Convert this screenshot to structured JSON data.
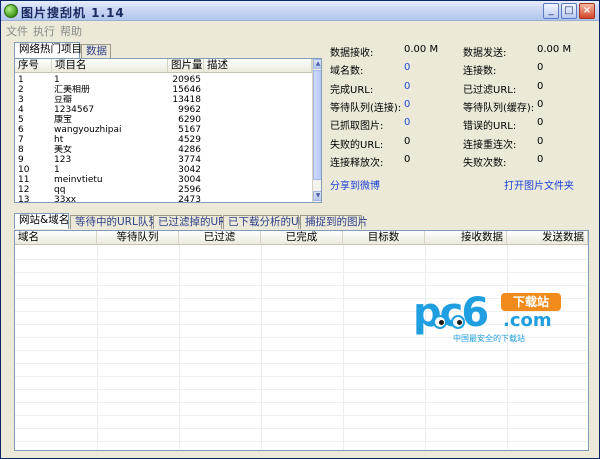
{
  "window": {
    "title": "图片搜刮机 1.14",
    "min": "_",
    "max": "□",
    "close": "×"
  },
  "menu": [
    "文件",
    "执行",
    "帮助"
  ],
  "top_tabs": [
    "网络热门项目",
    "数据"
  ],
  "top_grid": {
    "headers": [
      "序号",
      "项目名",
      "图片量",
      "描述"
    ],
    "rows": [
      [
        "1",
        "1",
        "20965",
        ""
      ],
      [
        "2",
        "汇美相册",
        "15646",
        ""
      ],
      [
        "3",
        "豆瓣",
        "13418",
        ""
      ],
      [
        "4",
        "1234567",
        "9962",
        ""
      ],
      [
        "5",
        "康宝",
        "6290",
        ""
      ],
      [
        "6",
        "wangyouzhipai",
        "5167",
        ""
      ],
      [
        "7",
        "ht",
        "4529",
        ""
      ],
      [
        "8",
        "美女",
        "4286",
        ""
      ],
      [
        "9",
        "123",
        "3774",
        ""
      ],
      [
        "10",
        "1",
        "3042",
        ""
      ],
      [
        "11",
        "meinvtietu",
        "3004",
        ""
      ],
      [
        "12",
        "qq",
        "2596",
        ""
      ],
      [
        "13",
        "33xx",
        "2473",
        ""
      ]
    ]
  },
  "stats_left": [
    {
      "label": "数据接收:",
      "value": "0.00 M",
      "blue": false
    },
    {
      "label": "域名数:",
      "value": "0",
      "blue": true
    },
    {
      "label": "完成URL:",
      "value": "0",
      "blue": true
    },
    {
      "label": "等待队列(连接):",
      "value": "0",
      "blue": true
    },
    {
      "label": "已抓取图片:",
      "value": "0",
      "blue": true
    },
    {
      "label": "失败的URL:",
      "value": "0",
      "blue": false
    },
    {
      "label": "连接释放次:",
      "value": "0",
      "blue": false
    }
  ],
  "stats_right": [
    {
      "label": "数据发送:",
      "value": "0.00 M"
    },
    {
      "label": "连接数:",
      "value": "0"
    },
    {
      "label": "已过滤URL:",
      "value": "0"
    },
    {
      "label": "等待队列(缓存):",
      "value": "0"
    },
    {
      "label": "错误的URL:",
      "value": "0"
    },
    {
      "label": "连接重连次:",
      "value": "0"
    },
    {
      "label": "失败次数:",
      "value": "0"
    }
  ],
  "links": {
    "share": "分享到微博",
    "open_folder": "打开图片文件夹"
  },
  "bottom_tabs": [
    "网站&域名",
    "等待中的URL队列",
    "已过滤掉的URL",
    "已下载分析的URL",
    "捕捉到的图片"
  ],
  "bottom_grid": {
    "headers": [
      "域名",
      "等待队列",
      "已过滤",
      "已完成",
      "目标数",
      "接收数据",
      "发送数据"
    ]
  },
  "watermark": {
    "pc6": "pc6",
    "badge": "下载站",
    "com": ".com",
    "sub": "中国最安全的下载站"
  }
}
